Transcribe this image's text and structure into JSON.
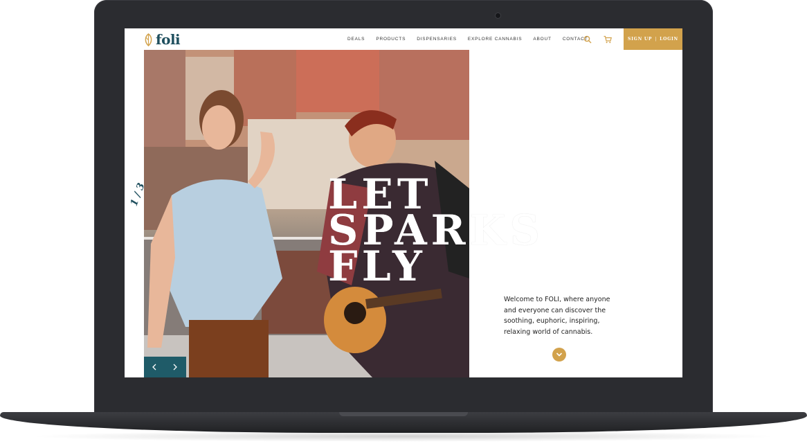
{
  "brand": {
    "name": "foli",
    "color": "#1f4f5e",
    "accent": "#d2a24c"
  },
  "nav": {
    "items": [
      {
        "label": "DEALS"
      },
      {
        "label": "PRODUCTS"
      },
      {
        "label": "DISPENSARIES"
      },
      {
        "label": "EXPLORE CANNABIS"
      },
      {
        "label": "ABOUT"
      },
      {
        "label": "CONTACT"
      }
    ],
    "search_icon": "search-icon",
    "cart_icon": "cart-icon"
  },
  "auth": {
    "signup_label": "SIGN UP",
    "separator": "|",
    "login_label": "LOGIN"
  },
  "hero": {
    "slide_counter": "1 / 3",
    "headline_line1": "LET",
    "headline_line2": "SPARKS",
    "headline_line3": "FLY",
    "prev_icon": "chevron-left-icon",
    "next_icon": "chevron-right-icon",
    "image": "photo of a laughing woman and a man playing an acoustic guitar on a rooftop"
  },
  "intro": {
    "text": "Welcome to FOLI, where anyone and everyone can discover the soothing, euphoric, inspiring, relaxing world of cannabis.",
    "scroll_icon": "chevron-down-icon"
  }
}
